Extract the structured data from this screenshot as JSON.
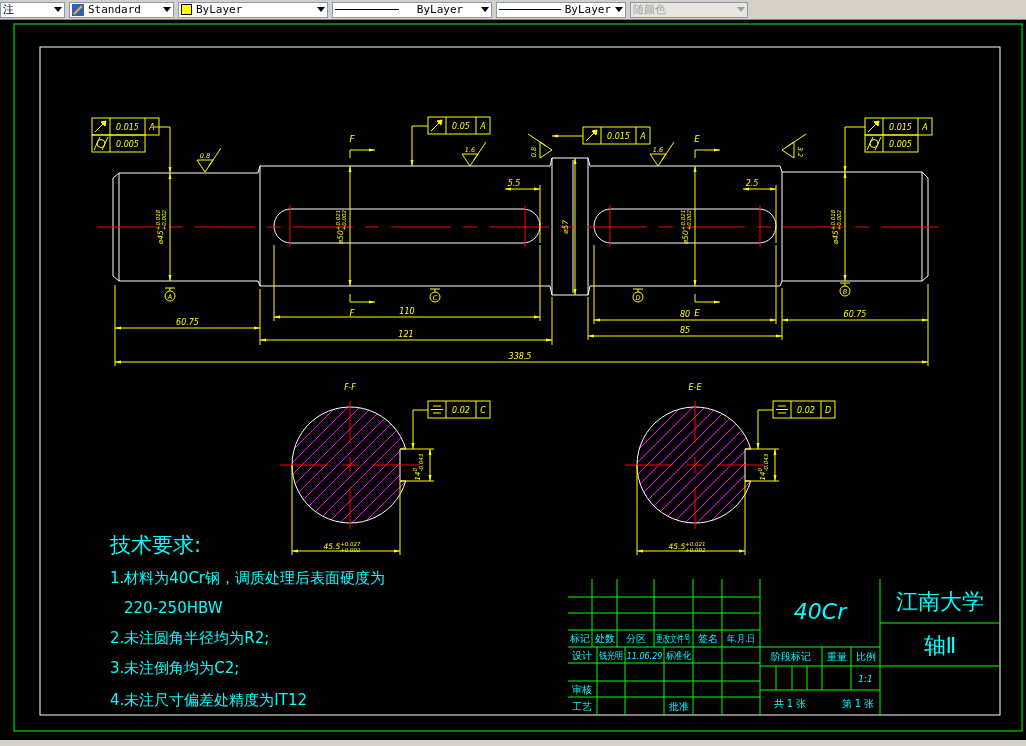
{
  "toolbar": {
    "combos": [
      {
        "kind": "dimstyle",
        "value": "注",
        "disabled": false
      },
      {
        "kind": "textstyle",
        "value": "Standard",
        "disabled": false
      },
      {
        "kind": "layer",
        "value": "ByLayer",
        "disabled": false
      },
      {
        "kind": "linetype",
        "value": "ByLayer",
        "disabled": false
      },
      {
        "kind": "lineweight",
        "value": "ByLayer",
        "disabled": false
      },
      {
        "kind": "plotstyle",
        "value": "随颜色",
        "disabled": true
      }
    ]
  },
  "drawing": {
    "tolerance_frames": [
      {
        "kind": "runout",
        "tolerance": "0.015",
        "datum": "A"
      },
      {
        "kind": "cylindricity",
        "tolerance": "0.005"
      },
      {
        "kind": "runout",
        "tolerance": "0.05",
        "datum": "A"
      },
      {
        "kind": "runout",
        "tolerance": "0.015",
        "datum": "A"
      },
      {
        "kind": "runout",
        "tolerance": "0.015",
        "datum": "A"
      },
      {
        "kind": "cylindricity",
        "tolerance": "0.005"
      }
    ],
    "roughness": [
      "0.8",
      "1.6",
      "0.8",
      "1.6",
      "3.2"
    ],
    "section_marks": [
      "F",
      "F",
      "E",
      "E"
    ],
    "datums": [
      "A",
      "C",
      "D",
      "B"
    ],
    "diameters": [
      {
        "value": "⌀45",
        "upper": "+0.018",
        "lower": "+0.002"
      },
      {
        "value": "⌀50",
        "upper": "+0.021",
        "lower": "+0.002"
      },
      {
        "value": "⌀57"
      },
      {
        "value": "⌀50",
        "upper": "+0.021",
        "lower": "+0.002"
      },
      {
        "value": "⌀45",
        "upper": "+0.018",
        "lower": "+0.002"
      }
    ],
    "lengths": [
      "5.5",
      "2.5",
      "60.75",
      "110",
      "121",
      "80",
      "85",
      "60.75",
      "338.5"
    ],
    "sections": [
      {
        "title": "F-F",
        "frame": {
          "kind": "symmetry",
          "tolerance": "0.02",
          "datum": "C"
        },
        "key": {
          "value": "14",
          "upper": "0",
          "lower": "-0.043"
        },
        "depth": {
          "value": "45.5",
          "upper": "+0.027",
          "lower": "+0.002"
        }
      },
      {
        "title": "E-E",
        "frame": {
          "kind": "symmetry",
          "tolerance": "0.02",
          "datum": "D"
        },
        "key": {
          "value": "14",
          "upper": "0",
          "lower": "-0.043"
        },
        "depth": {
          "value": "45.5",
          "upper": "+0.021",
          "lower": "+0.002"
        }
      }
    ],
    "notes": {
      "title": "技术要求:",
      "lines": [
        "1.材料为40Cr钢，调质处理后表面硬度为",
        "220-250HBW",
        "2.未注圆角半径均为R2;",
        "3.未注倒角均为C2;",
        "4.未注尺寸偏差处精度为IT12"
      ]
    },
    "title_block": {
      "material": "40Cr",
      "school": "江南大学",
      "part": "轴Ⅱ",
      "headers": [
        "标记",
        "处数",
        "分区",
        "更改文件号",
        "签名",
        "年.月.日"
      ],
      "design": {
        "label": "设计",
        "name": "钱光明",
        "date": "11.06.29",
        "standard": "标准化"
      },
      "review": "审核",
      "process": "工艺",
      "approve": "批准",
      "stage": "阶段标记",
      "weight": "重量",
      "scale_label": "比例",
      "scale": "1:1",
      "sheets": "共 1 张",
      "sheet": "第 1 张"
    }
  }
}
